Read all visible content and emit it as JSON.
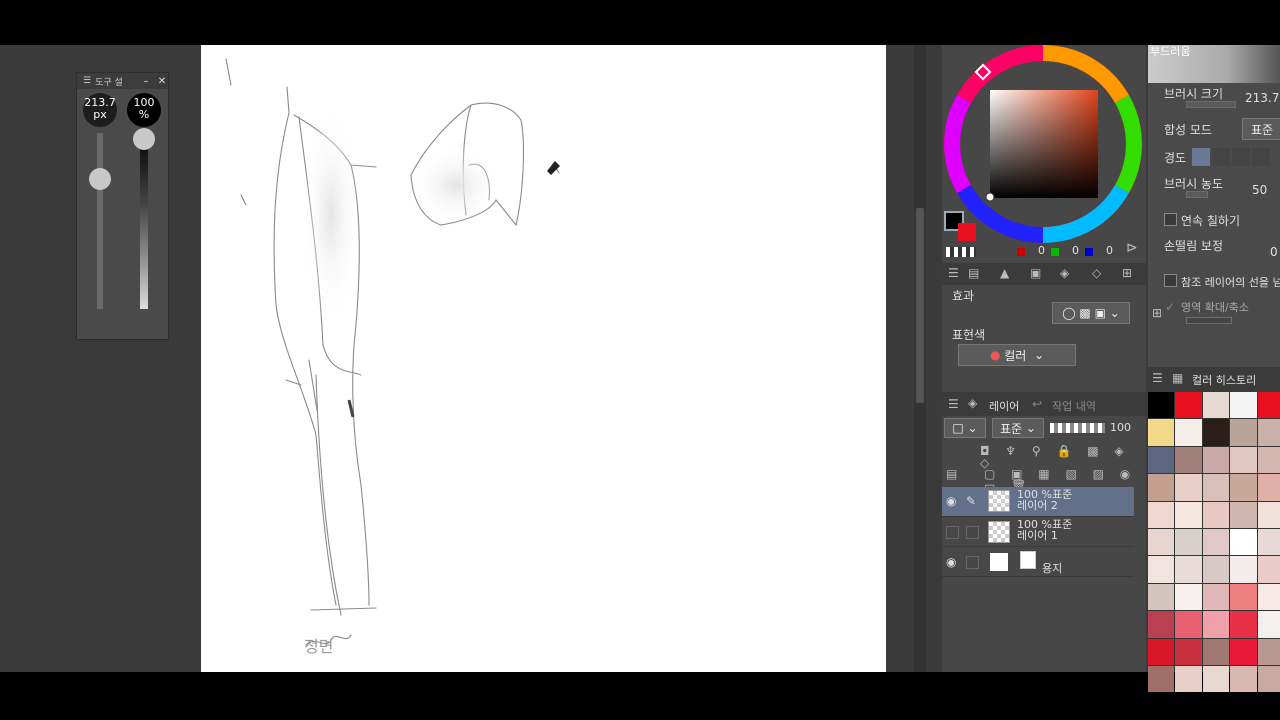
{
  "tool_panel": {
    "title": "도구 설",
    "brush_size": "213.7",
    "brush_unit": "px",
    "opacity": "100",
    "opacity_unit": "%"
  },
  "canvas": {
    "sketch_label": "정면"
  },
  "color": {
    "main_color": "#000000",
    "sub_color": "#e8101e",
    "r": "0",
    "g": "0",
    "b": "0"
  },
  "tool_property": {
    "brush_preview_label": "부드러움",
    "brush_size_label": "브러시 크기",
    "brush_size_value": "213.7",
    "blend_mode_label": "합성 모드",
    "blend_mode_value": "표준",
    "hardness_label": "경도",
    "density_label": "브러시 농도",
    "density_value": "50",
    "continuous_label": "연속 칠하기",
    "stabilization_label": "손떨림 보정",
    "stabilization_value": "0",
    "reference_label": "참조 레이어의 선을 넘",
    "expand_label": "영역 확대/축소"
  },
  "sub_tool": {
    "effect_label": "효과",
    "expression_label": "표현색",
    "expression_value": "컬러"
  },
  "layer_panel": {
    "tab_layer": "레이어",
    "tab_history": "작업 내역",
    "blend_value": "표준",
    "opacity_value": "100",
    "layers": [
      {
        "mode": "100 %표준",
        "name": "레이어 2"
      },
      {
        "mode": "100 %표준",
        "name": "레이어 1"
      },
      {
        "mode": "",
        "name": "용지"
      }
    ]
  },
  "color_history": {
    "title": "컬러 히스토리",
    "swatches": [
      "#000000",
      "#e8101e",
      "#e8d8d2",
      "#f4f4f4",
      "#e8101e",
      "#f2d98a",
      "#f5eee8",
      "#2a1e1a",
      "#b9a49a",
      "#c9b0a8",
      "#5c6680",
      "#a08078",
      "#c8a8a8",
      "#e0c8c0",
      "#d4b8b0",
      "#c4a090",
      "#e8d0c8",
      "#d8c0b8",
      "#c8a898",
      "#e0b0a8",
      "#f0d8d0",
      "#f4e8e0",
      "#e8c8c0",
      "#d0b8b0",
      "#f0e0dc",
      "#e8d4d0",
      "#d8d0cc",
      "#e0c8c8",
      "#ffffff",
      "#e8d8d8",
      "#f0e4e0",
      "#e8dcd8",
      "#d8c8c8",
      "#f4ecea",
      "#e8ccc8",
      "#d4c4c0",
      "#f8f0ee",
      "#e0b8b8",
      "#f08080",
      "#f8e8e8",
      "#b84050",
      "#e86070",
      "#f0a0a8",
      "#e83048",
      "#f4f0f0",
      "#d81828",
      "#c83040",
      "#a07870",
      "#e81838",
      "#b89890",
      "#a07068",
      "#e8d0c8",
      "#e8d8d0",
      "#d8b8b0",
      "#c8a8a0"
    ]
  }
}
